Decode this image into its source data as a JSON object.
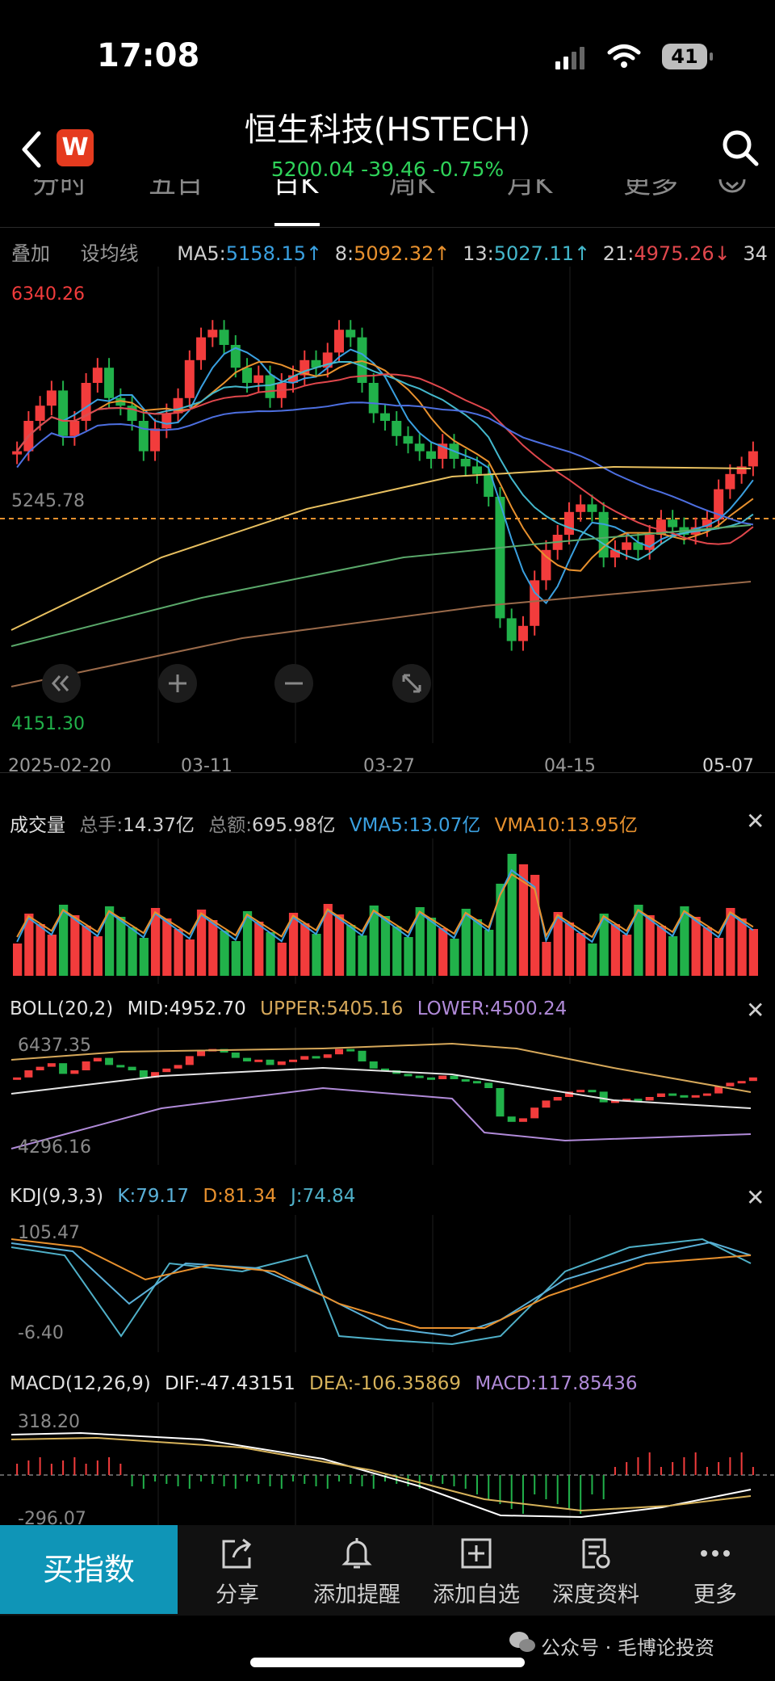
{
  "status_bar": {
    "time": "17:08",
    "battery": "41"
  },
  "header": {
    "title": "恒生科技(HSTECH)",
    "price": "5200.04",
    "change": "-39.46",
    "change_pct": "-0.75%",
    "logo_letter": "W"
  },
  "tabs": [
    {
      "label": "分时"
    },
    {
      "label": "五日"
    },
    {
      "label": "日K",
      "active": true
    },
    {
      "label": "周K"
    },
    {
      "label": "月K"
    },
    {
      "label": "更多"
    }
  ],
  "ma_bar": {
    "overlay": "叠加",
    "set_ma": "设均线",
    "ma5_label": "MA5:",
    "ma5_value": "5158.15↑",
    "ma8_label": "8:",
    "ma8_value": "5092.32↑",
    "ma13_label": "13:",
    "ma13_value": "5027.11↑",
    "ma21_label": "21:",
    "ma21_value": "4975.26↓",
    "ma34_partial": "34"
  },
  "main_chart": {
    "high_label": "6340.26",
    "ref_label": "5245.78",
    "low_label": "4151.30",
    "dates": [
      "2025-02-20",
      "03-11",
      "03-27",
      "04-15",
      "05-07"
    ],
    "up_color": "#f23c3c",
    "down_color": "#21b14a"
  },
  "volume_panel": {
    "title": "成交量",
    "total_hands_label": "总手:",
    "total_hands": "14.37亿",
    "total_amount_label": "总额:",
    "total_amount": "695.98亿",
    "vma5_label": "VMA5:",
    "vma5": "13.07亿",
    "vma10_label": "VMA10:",
    "vma10": "13.95亿"
  },
  "boll_panel": {
    "title": "BOLL(20,2)",
    "mid_label": "MID:",
    "mid": "4952.70",
    "upper_label": "UPPER:",
    "upper": "5405.16",
    "lower_label": "LOWER:",
    "lower": "4500.24",
    "high_label": "6437.35",
    "low_label": "4296.16"
  },
  "kdj_panel": {
    "title": "KDJ(9,3,3)",
    "k_label": "K:",
    "k": "79.17",
    "d_label": "D:",
    "d": "81.34",
    "j_label": "J:",
    "j": "74.84",
    "high_label": "105.47",
    "low_label": "-6.40"
  },
  "macd_panel": {
    "title": "MACD(12,26,9)",
    "dif_label": "DIF:",
    "dif": "-47.43151",
    "dea_label": "DEA:",
    "dea": "-106.35869",
    "macd_label": "MACD:",
    "macd": "117.85436",
    "high_label": "318.20",
    "low_label": "-296.07"
  },
  "bottom_bar": {
    "buy": "买指数",
    "items": [
      {
        "label": "分享"
      },
      {
        "label": "添加提醒"
      },
      {
        "label": "添加自选"
      },
      {
        "label": "深度资料"
      },
      {
        "label": "更多"
      }
    ]
  },
  "watermark": "公众号 · 毛博论投资",
  "close_symbol": "✕",
  "colors": {
    "ma5": "#3aa0e0",
    "ma8": "#e8912e",
    "ma13": "#44b8cc",
    "ma21": "#e0474c",
    "ma34": "#4d6fe0",
    "ma55": "#e8c060",
    "ma89": "#5aa86a",
    "ma144": "#9a6a4a",
    "boll_upper": "#d6a85a",
    "boll_mid": "#e6e6e6",
    "boll_lower": "#b08ad8",
    "kdj_k": "#5ab0d8",
    "kdj_d": "#e8912e",
    "kdj_j": "#4fb0c8",
    "macd_dif": "#ffffff",
    "macd_dea": "#d6b25a",
    "macd_label": "#b08ad8",
    "buy_bg": "#0f95b7",
    "ref_line": "#e8912e"
  }
}
